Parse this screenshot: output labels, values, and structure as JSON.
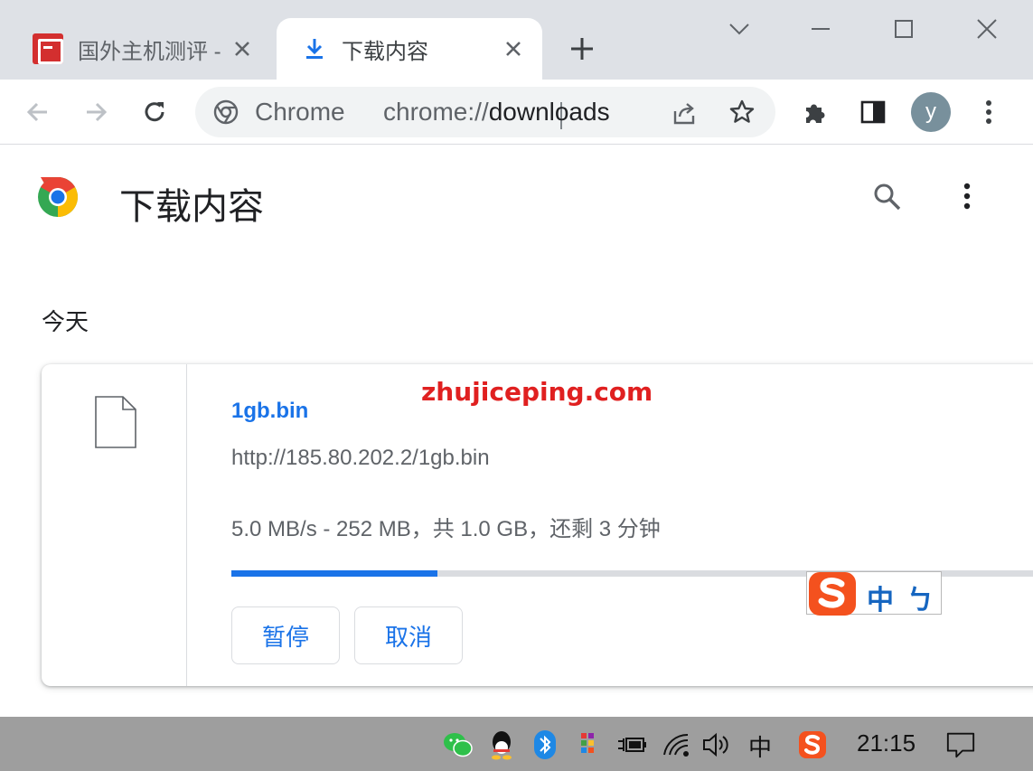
{
  "tabs": [
    {
      "title": "国外主机测评 - ",
      "active": false,
      "favicon": "site-icon-red"
    },
    {
      "title": "下载内容",
      "active": true,
      "favicon": "download-icon"
    }
  ],
  "omnibox": {
    "site_label": "Chrome",
    "url_prefix": "chrome://",
    "url_path": "downloads"
  },
  "profile": {
    "initial": "y"
  },
  "page": {
    "title": "下载内容"
  },
  "downloads": {
    "date_header": "今天",
    "items": [
      {
        "file_name": "1gb.bin",
        "url": "http://185.80.202.2/1gb.bin",
        "status": "5.0 MB/s - 252 MB，共 1.0 GB，还剩 3 分钟",
        "progress": 0.25,
        "pause_label": "暂停",
        "cancel_label": "取消"
      }
    ]
  },
  "watermark": "zhujiceping.com",
  "ime": {
    "char1": "中",
    "char2": "ㄅ"
  },
  "taskbar": {
    "ime_mode": "中",
    "clock": "21:15"
  },
  "colors": {
    "accent": "#1a73e8",
    "watermark": "#e02020",
    "ime_orange": "#f4511e"
  }
}
